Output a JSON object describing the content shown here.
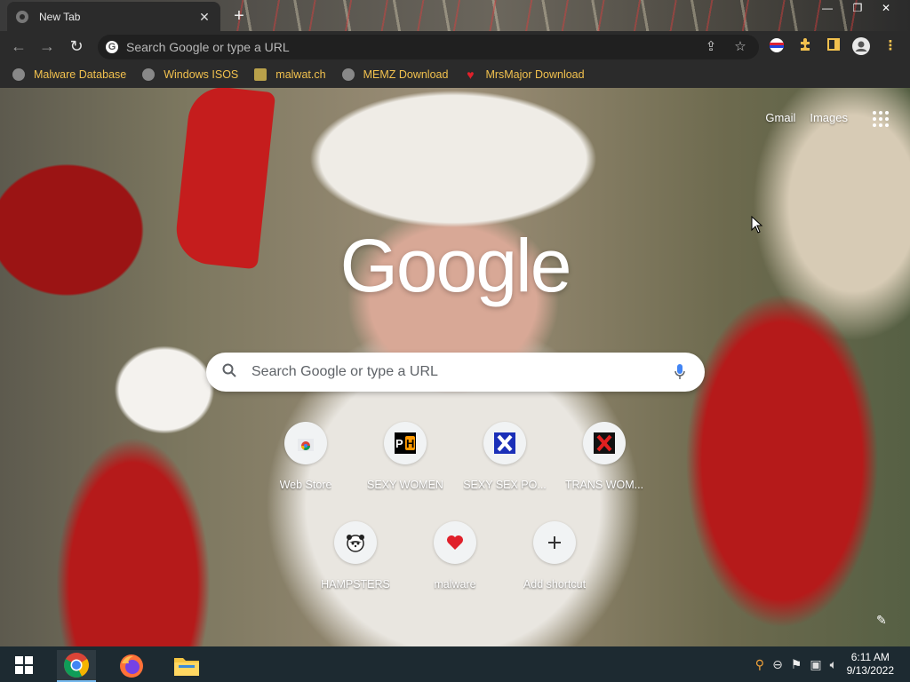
{
  "window": {
    "tab_title": "New Tab",
    "tab_close": "✕",
    "new_tab": "+",
    "minimize": "—",
    "restore": "❐",
    "close": "✕"
  },
  "toolbar": {
    "back": "←",
    "forward": "→",
    "reload": "↻",
    "omnibox_placeholder": "Search Google or type a URL",
    "share": "⇪",
    "star": "☆",
    "menu": "⋮"
  },
  "bookmarks": [
    {
      "label": "Malware Database",
      "icon": "globe-icon"
    },
    {
      "label": "Windows ISOS",
      "icon": "globe-icon"
    },
    {
      "label": "malwat.ch",
      "icon": "trophy-icon"
    },
    {
      "label": "MEMZ Download",
      "icon": "globe-icon"
    },
    {
      "label": "MrsMajor Download",
      "icon": "heart-icon"
    }
  ],
  "newtab": {
    "gmail": "Gmail",
    "images": "Images",
    "logo": "Google",
    "search_placeholder": "Search Google or type a URL",
    "shortcuts": [
      {
        "label": "Web Store",
        "icon": "chrome-webstore-icon"
      },
      {
        "label": "SEXY WOMEN",
        "icon": "ph-icon"
      },
      {
        "label": "SEXY SEX PO...",
        "icon": "x-blue-icon"
      },
      {
        "label": "TRANS WOM...",
        "icon": "x-red-icon"
      },
      {
        "label": "HAMPSTERS",
        "icon": "hamster-icon"
      },
      {
        "label": "malware",
        "icon": "heart-icon"
      },
      {
        "label": "Add shortcut",
        "icon": "plus-icon"
      }
    ]
  },
  "taskbar": {
    "time": "6:11 AM",
    "date": "9/13/2022"
  },
  "colors": {
    "bookmark_text": "#f2c14e",
    "toolbar_bg": "#2b2b2b",
    "taskbar_bg": "#1d2a31"
  }
}
